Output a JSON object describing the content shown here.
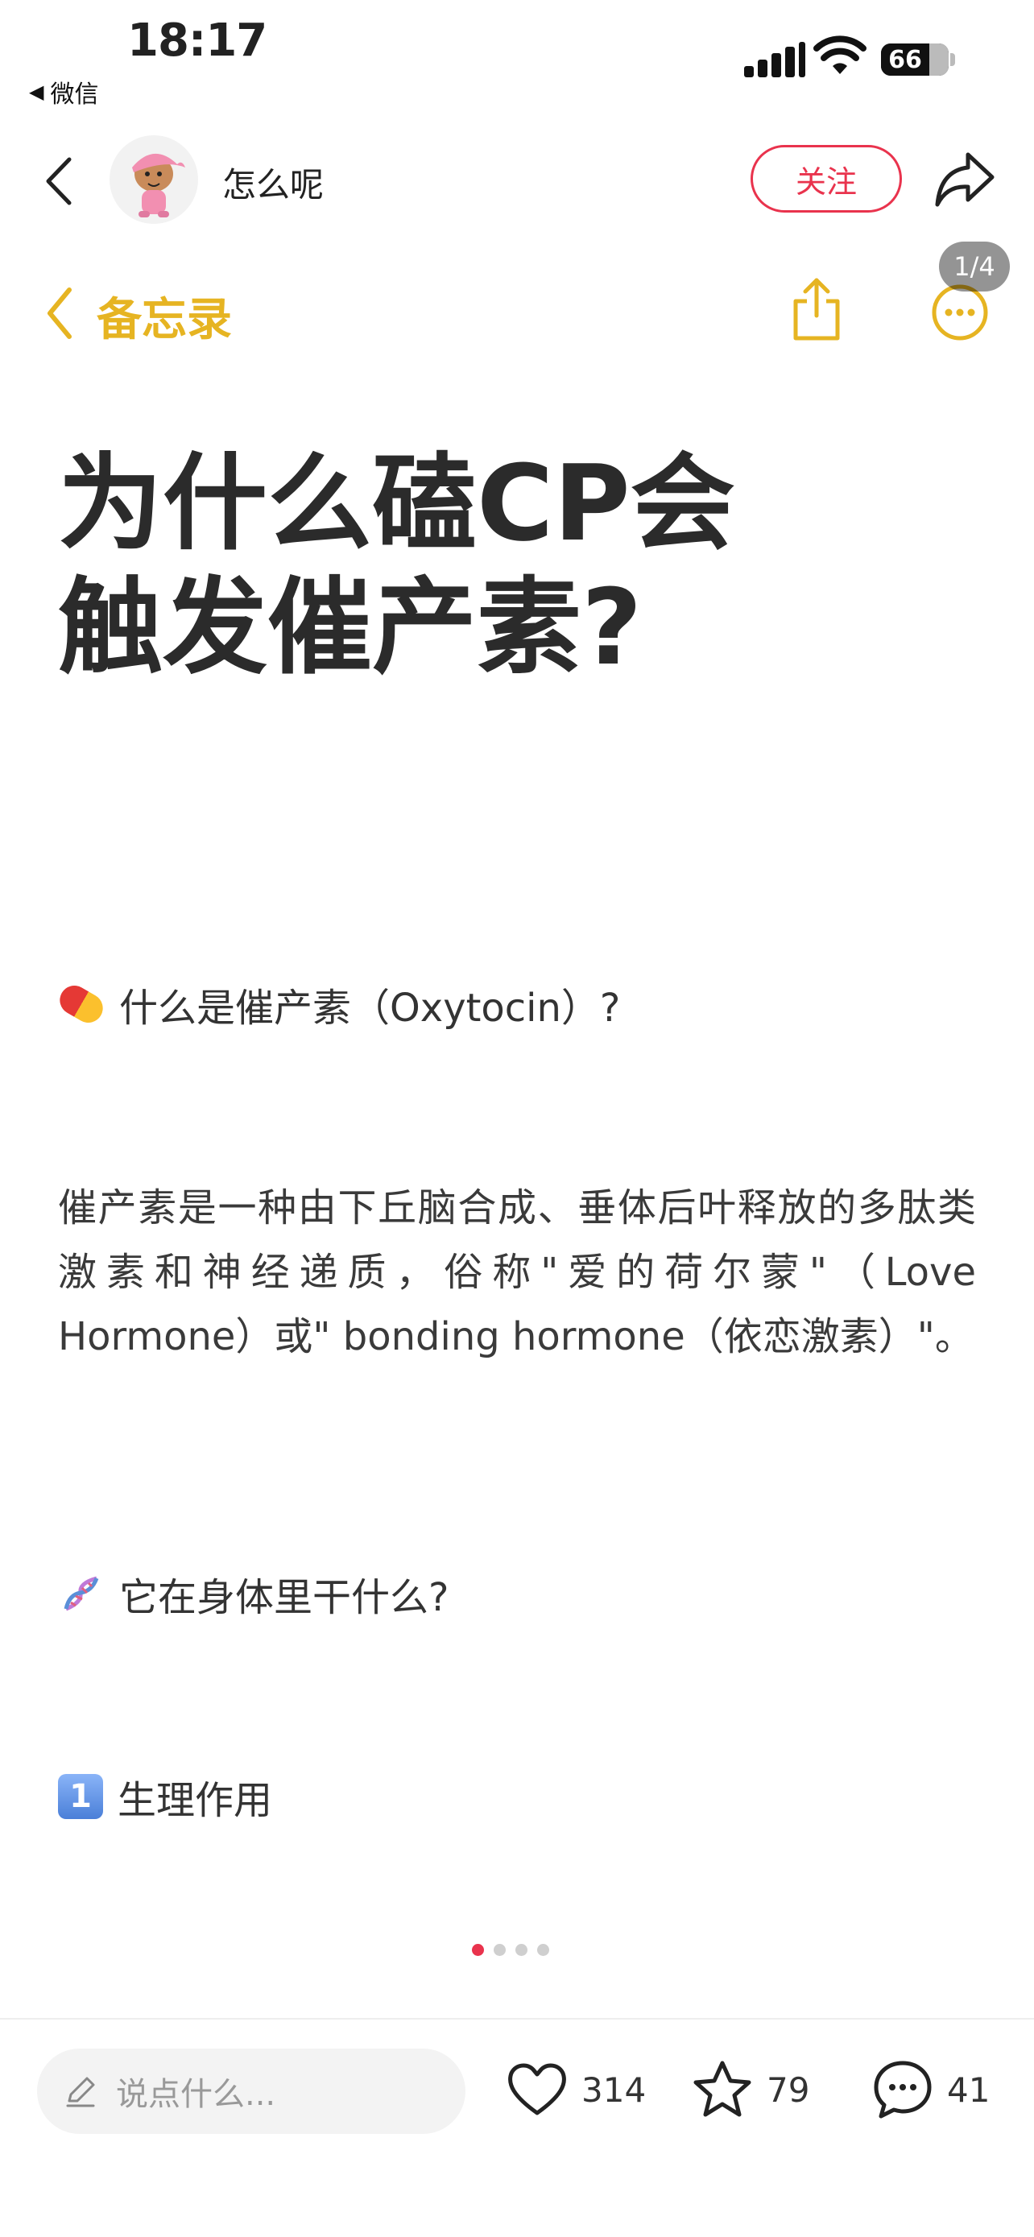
{
  "status_bar": {
    "time": "18:17",
    "back_app": "微信",
    "battery": "66"
  },
  "header": {
    "username": "怎么呢",
    "follow_label": "关注"
  },
  "notes_bar": {
    "label": "备忘录",
    "page_indicator": "1/4"
  },
  "content": {
    "title_line1": "为什么磕CP会",
    "title_line2": "触发催产素?",
    "section1": "什么是催产素（Oxytocin）?",
    "paragraph": "催产素是一种由下丘脑合成、垂体后叶释放的多肽类激素和神经递质，俗称\"爱的荷尔蒙\"（Love Hormone）或\" bonding hormone（依恋激素）\"。",
    "section2": "它在身体里干什么?",
    "section3": "生理作用",
    "section3_badge": "1"
  },
  "carousel": {
    "total": 4,
    "active": 1
  },
  "bottom_bar": {
    "comment_placeholder": "说点什么...",
    "likes": "314",
    "stars": "79",
    "comments": "41"
  },
  "colors": {
    "accent_red": "#e9334d",
    "notes_yellow": "#e6b422"
  }
}
